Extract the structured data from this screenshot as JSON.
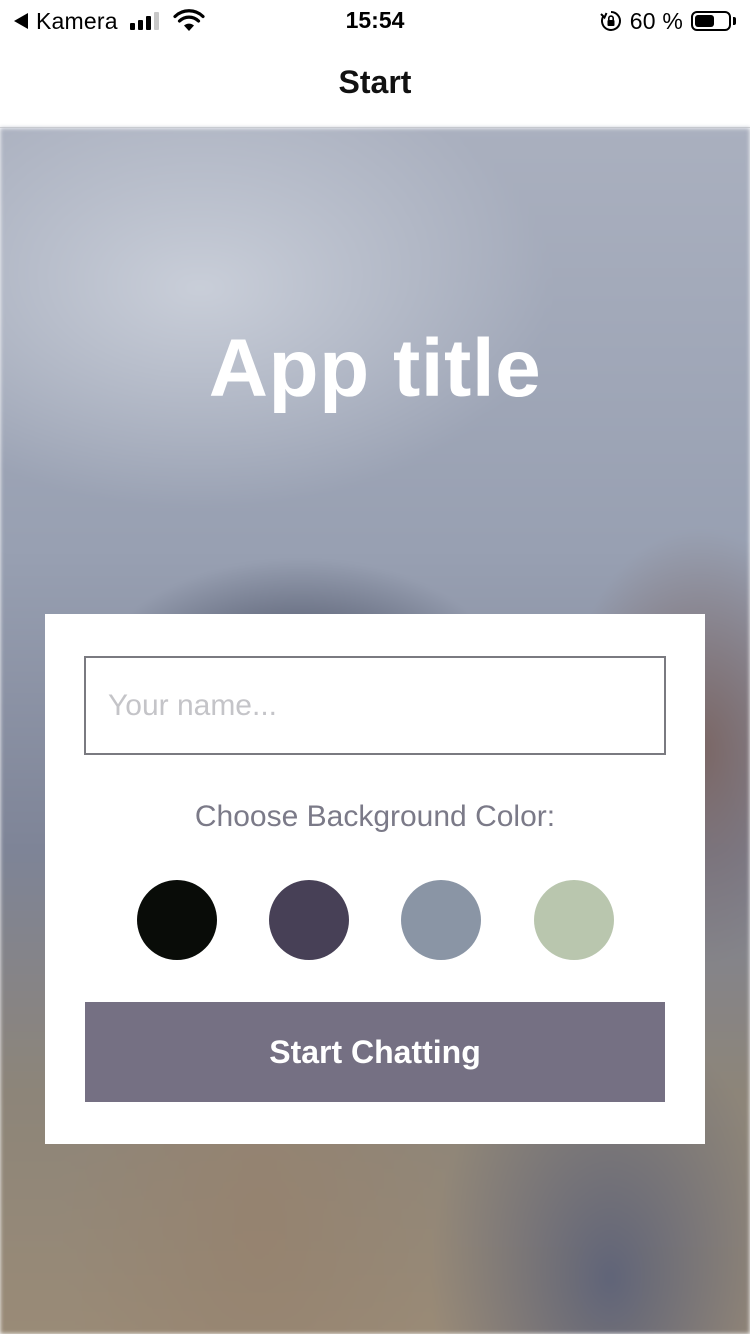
{
  "status_bar": {
    "back_app": "Kamera",
    "time": "15:54",
    "battery_percent": "60 %",
    "battery_level": 0.6,
    "signal_bars": 3,
    "icons": [
      "back-arrow-icon",
      "signal-icon",
      "wifi-icon",
      "orientation-lock-icon",
      "battery-icon"
    ]
  },
  "nav": {
    "title": "Start"
  },
  "hero": {
    "app_title": "App title"
  },
  "form": {
    "name_placeholder": "Your name...",
    "name_value": "",
    "color_label": "Choose Background Color:",
    "colors": [
      "#090C08",
      "#474056",
      "#8A95A5",
      "#B9C6AE"
    ],
    "button_label": "Start Chatting",
    "button_color": "#757083"
  }
}
